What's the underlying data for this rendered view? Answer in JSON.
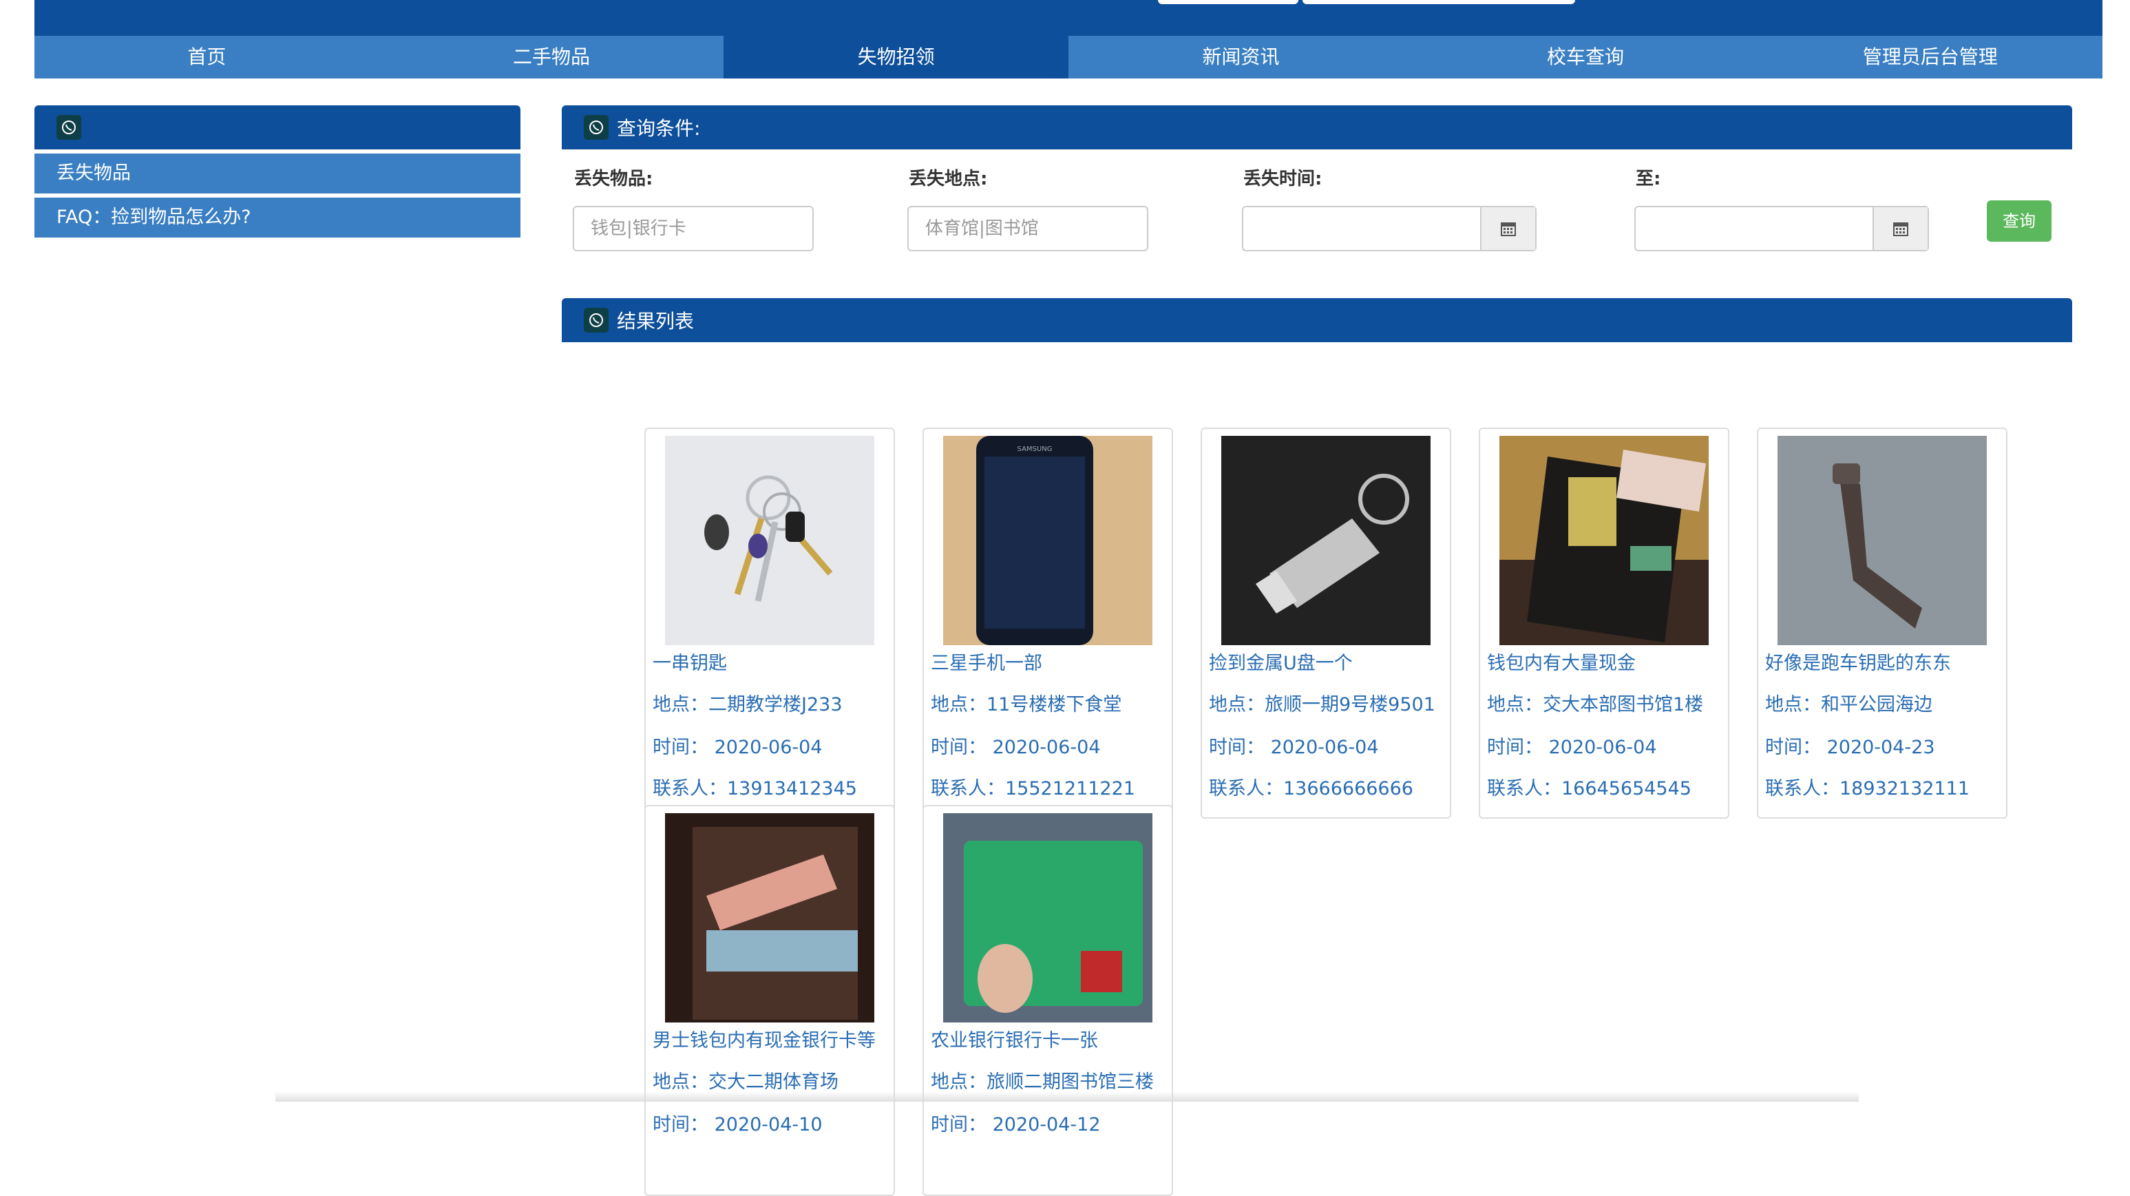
{
  "nav": {
    "items": [
      {
        "label": "首页"
      },
      {
        "label": "二手物品"
      },
      {
        "label": "失物招领"
      },
      {
        "label": "新闻资讯"
      },
      {
        "label": "校车查询"
      },
      {
        "label": "管理员后台管理"
      }
    ],
    "active_index": 2
  },
  "sidebar": {
    "header_title": "",
    "links": [
      {
        "label": "丢失物品"
      },
      {
        "label": "FAQ：捡到物品怎么办?"
      }
    ]
  },
  "query": {
    "header_title": "查询条件:",
    "item_label": "丢失物品:",
    "item_placeholder": "钱包|银行卡",
    "place_label": "丢失地点:",
    "place_placeholder": "体育馆|图书馆",
    "time_label": "丢失时间:",
    "to_label": "至:",
    "button_label": "查询"
  },
  "results": {
    "header_title": "结果列表",
    "items": [
      {
        "title": "一串钥匙",
        "place": "地点：二期教学楼J233",
        "time": "时间：  2020-06-04",
        "contact": "联系人：13913412345",
        "image": "keys"
      },
      {
        "title": "三星手机一部",
        "place": "地点：11号楼楼下食堂",
        "time": "时间：  2020-06-04",
        "contact": "联系人：15521211221",
        "image": "phone"
      },
      {
        "title": "捡到金属U盘一个",
        "place": "地点：旅顺一期9号楼9501",
        "time": "时间：  2020-06-04",
        "contact": "联系人：13666666666",
        "image": "usb"
      },
      {
        "title": "钱包内有大量现金",
        "place": "地点：交大本部图书馆1楼",
        "time": "时间：  2020-06-04",
        "contact": "联系人：16645654545",
        "image": "wallet"
      },
      {
        "title": "好像是跑车钥匙的东东",
        "place": "地点：和平公园海边",
        "time": "时间：  2020-04-23",
        "contact": "联系人：18932132111",
        "image": "crank"
      },
      {
        "title": "男士钱包内有现金银行卡等",
        "place": "地点：交大二期体育场",
        "time": "时间：  2020-04-10",
        "contact": "",
        "image": "wallet2"
      },
      {
        "title": "农业银行银行卡一张",
        "place": "地点：旅顺二期图书馆三楼",
        "time": "时间：  2020-04-12",
        "contact": "",
        "image": "bankcard"
      }
    ]
  },
  "colors": {
    "primary": "#0d4f9a",
    "secondary": "#3a7fc3",
    "link": "#2a6db3",
    "success": "#5cb85c"
  }
}
